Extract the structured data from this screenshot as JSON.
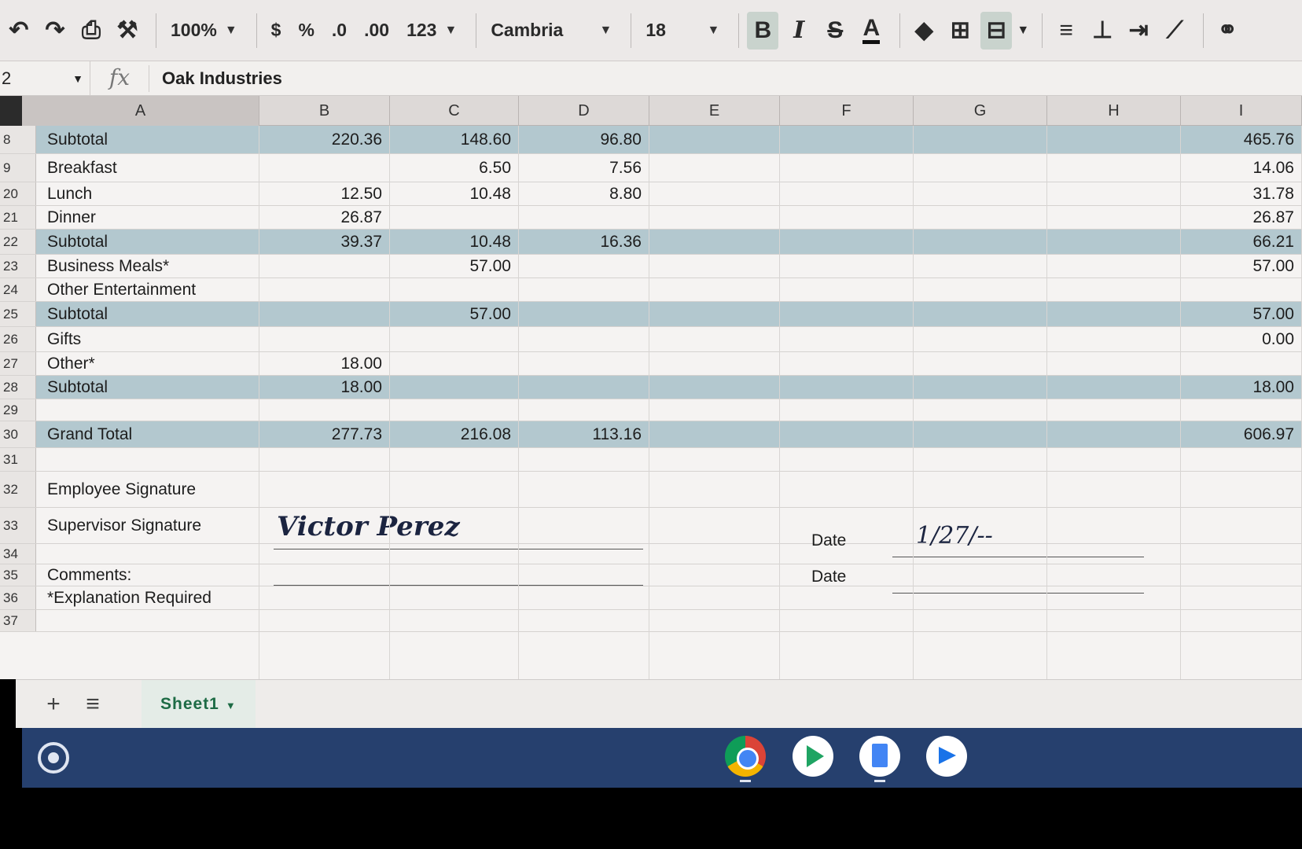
{
  "toolbar": {
    "zoom": "100%",
    "currency": "$",
    "percent": "%",
    "dec_decrease": ".0",
    "dec_increase": ".00",
    "format_more": "123",
    "font": "Cambria",
    "font_size": "18",
    "bold": "B",
    "italic": "I",
    "strike": "S",
    "text_color": "A"
  },
  "formula_bar": {
    "cell_ref": "2",
    "fx": "fx",
    "value": "Oak Industries"
  },
  "columns": [
    "A",
    "B",
    "C",
    "D",
    "E",
    "F",
    "G",
    "H",
    "I"
  ],
  "rows": [
    {
      "num": "8",
      "label": "Subtotal",
      "sub": true,
      "b": "220.36",
      "c": "148.60",
      "d": "96.80",
      "i": "465.76"
    },
    {
      "num": "9",
      "label": "Breakfast",
      "b": "",
      "c": "6.50",
      "d": "7.56",
      "i": "14.06"
    },
    {
      "num": "20",
      "label": "Lunch",
      "b": "12.50",
      "c": "10.48",
      "d": "8.80",
      "i": "31.78"
    },
    {
      "num": "21",
      "label": "Dinner",
      "b": "26.87",
      "c": "",
      "d": "",
      "i": "26.87"
    },
    {
      "num": "22",
      "label": "Subtotal",
      "sub": true,
      "b": "39.37",
      "c": "10.48",
      "d": "16.36",
      "i": "66.21"
    },
    {
      "num": "23",
      "label": "Business Meals*",
      "b": "",
      "c": "57.00",
      "d": "",
      "i": "57.00"
    },
    {
      "num": "24",
      "label": "Other Entertainment",
      "b": "",
      "c": "",
      "d": "",
      "i": ""
    },
    {
      "num": "25",
      "label": "Subtotal",
      "sub": true,
      "b": "",
      "c": "57.00",
      "d": "",
      "i": "57.00"
    },
    {
      "num": "26",
      "label": "Gifts",
      "b": "",
      "c": "",
      "d": "",
      "i": "0.00"
    },
    {
      "num": "27",
      "label": "Other*",
      "b": "18.00",
      "c": "",
      "d": "",
      "i": ""
    },
    {
      "num": "28",
      "label": "Subtotal",
      "sub": true,
      "b": "18.00",
      "c": "",
      "d": "",
      "i": "18.00"
    },
    {
      "num": "29",
      "label": "",
      "b": "",
      "c": "",
      "d": "",
      "i": ""
    },
    {
      "num": "30",
      "label": "Grand Total",
      "sub": true,
      "b": "277.73",
      "c": "216.08",
      "d": "113.16",
      "i": "606.97"
    },
    {
      "num": "31",
      "label": "",
      "b": "",
      "c": "",
      "d": "",
      "i": ""
    },
    {
      "num": "32",
      "label": "Employee Signature",
      "b": "",
      "c": "",
      "d": "",
      "i": ""
    },
    {
      "num": "33",
      "label": "Supervisor Signature",
      "b": "",
      "c": "",
      "d": "",
      "i": ""
    },
    {
      "num": "34",
      "label": "",
      "b": "",
      "c": "",
      "d": "",
      "i": ""
    },
    {
      "num": "35",
      "label": "Comments:",
      "b": "",
      "c": "",
      "d": "",
      "i": ""
    },
    {
      "num": "36",
      "label": "*Explanation Required",
      "b": "",
      "c": "",
      "d": "",
      "i": ""
    },
    {
      "num": "37",
      "label": "",
      "b": "",
      "c": "",
      "d": "",
      "i": ""
    }
  ],
  "signature": {
    "employee_name": "Victor Perez",
    "date_label_1": "Date",
    "date_value_1": "1/27/--",
    "date_label_2": "Date"
  },
  "sheet_tabs": {
    "add": "+",
    "all_sheets": "≡",
    "active": "Sheet1"
  },
  "colors": {
    "subtotal_fill": "#b3c8cf",
    "shelf": "#26406e",
    "sheet_tab_text": "#1d6b45"
  }
}
